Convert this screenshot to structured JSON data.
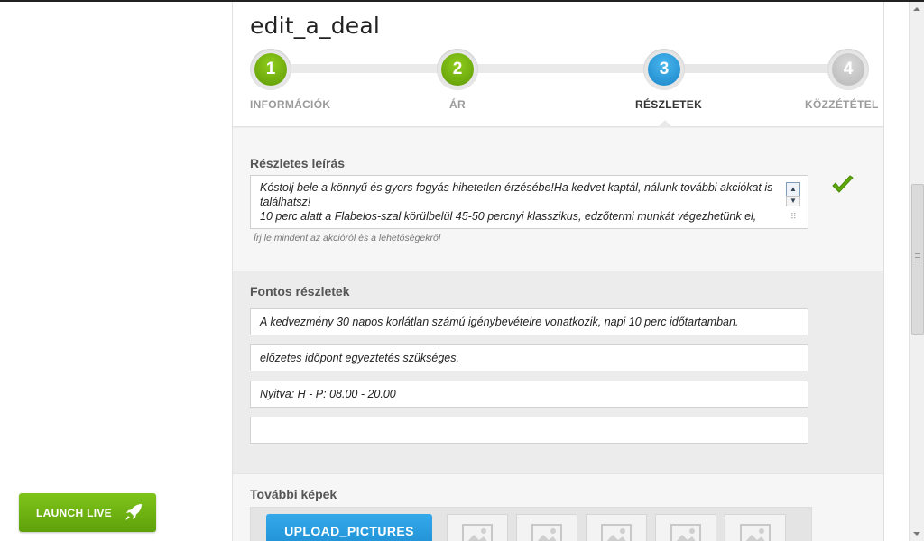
{
  "page": {
    "title": "edit_a_deal"
  },
  "stepper": {
    "steps": [
      {
        "number": "1",
        "label": "INFORMÁCIÓK",
        "state": "done"
      },
      {
        "number": "2",
        "label": "ÁR",
        "state": "done"
      },
      {
        "number": "3",
        "label": "RÉSZLETEK",
        "state": "active"
      },
      {
        "number": "4",
        "label": "KÖZZÉTÉTEL",
        "state": "todo"
      }
    ],
    "colors": {
      "done": "#6fae10",
      "active": "#2a9ee0",
      "todo": "#c4c4c4"
    }
  },
  "detailed_description": {
    "title": "Részletes leírás",
    "value_line1": "Kóstolj bele a könnyű és gyors fogyás hihetetlen érzésébe!Ha kedvet kaptál, nálunk további akciókat is",
    "value_line2": "találhatsz!",
    "value_line3": "10 perc alatt a Flabelos-szal körülbelül 45-50 percnyi klasszikus, edzőtermi munkát végezhetünk el,",
    "hint": "Írj le mindent az akcióról és a lehetőségekről",
    "valid_icon": "checkmark-icon"
  },
  "important_details": {
    "title": "Fontos részletek",
    "fields": [
      "A kedvezmény 30 napos korlátlan számú igénybevételre vonatkozik, napi 10 perc időtartamban.",
      "előzetes időpont egyeztetés szükséges.",
      "Nyitva: H - P: 08.00 - 20.00",
      ""
    ]
  },
  "more_images": {
    "title": "További képek",
    "upload_label": "UPLOAD_PICTURES",
    "placeholder_icon": "image-placeholder-icon"
  },
  "launch": {
    "label": "LAUNCH LIVE",
    "icon": "rocket-icon"
  }
}
